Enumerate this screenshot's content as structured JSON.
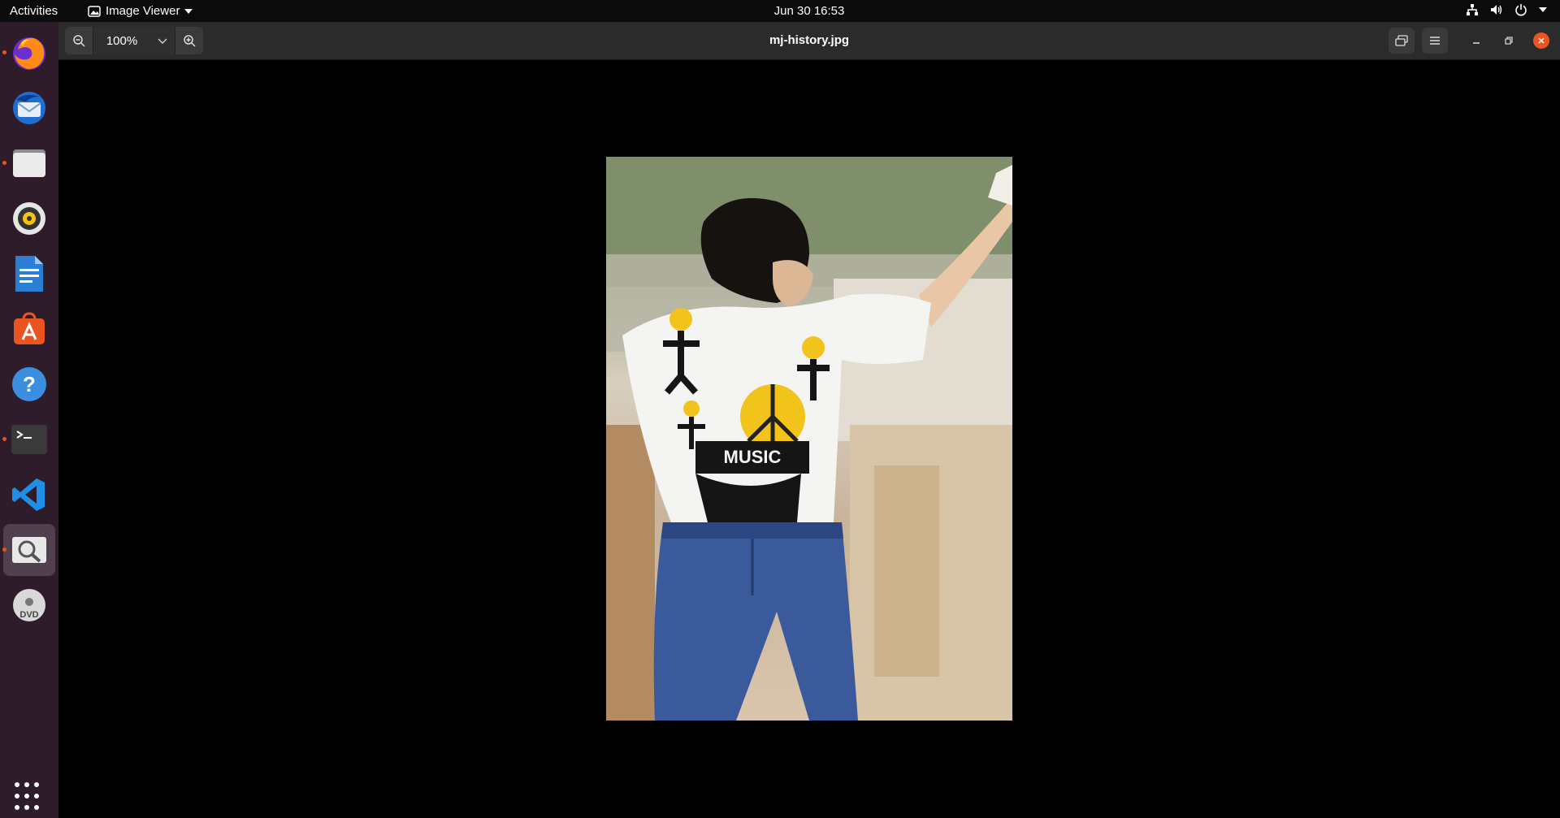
{
  "topbar": {
    "activities": "Activities",
    "app_menu": "Image Viewer",
    "clock": "Jun 30  16:53"
  },
  "dock": {
    "items": [
      {
        "name": "firefox-icon",
        "running": true
      },
      {
        "name": "thunderbird-icon",
        "running": false
      },
      {
        "name": "files-icon",
        "running": true
      },
      {
        "name": "rhythmbox-icon",
        "running": false
      },
      {
        "name": "libreoffice-writer-icon",
        "running": false
      },
      {
        "name": "ubuntu-software-icon",
        "running": false
      },
      {
        "name": "help-icon",
        "running": false
      },
      {
        "name": "terminal-icon",
        "running": true
      },
      {
        "name": "vscode-icon",
        "running": false
      },
      {
        "name": "image-viewer-icon",
        "running": true,
        "active": true
      },
      {
        "name": "dvd-icon",
        "running": false
      }
    ]
  },
  "viewer": {
    "zoom_value": "100%",
    "title": "mj-history.jpg"
  },
  "photo": {
    "shirt_text": "MUSIC"
  },
  "colors": {
    "accent": "#e95420",
    "dock_bg": "#2f1c2b",
    "headerbar_bg": "#2b2b2b"
  }
}
